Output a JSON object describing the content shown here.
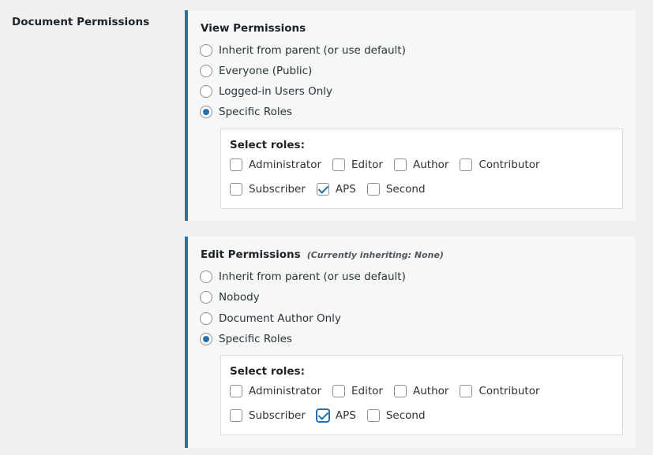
{
  "section_label": "Document Permissions",
  "view": {
    "title": "View Permissions",
    "options": [
      {
        "label": "Inherit from parent (or use default)",
        "checked": false
      },
      {
        "label": "Everyone (Public)",
        "checked": false
      },
      {
        "label": "Logged-in Users Only",
        "checked": false
      },
      {
        "label": "Specific Roles",
        "checked": true
      }
    ],
    "roles_title": "Select roles:",
    "roles_row1": [
      {
        "label": "Administrator",
        "checked": false
      },
      {
        "label": "Editor",
        "checked": false
      },
      {
        "label": "Author",
        "checked": false
      },
      {
        "label": "Contributor",
        "checked": false
      }
    ],
    "roles_row2": [
      {
        "label": "Subscriber",
        "checked": false
      },
      {
        "label": "APS",
        "checked": true
      },
      {
        "label": "Second",
        "checked": false
      }
    ]
  },
  "edit": {
    "title": "Edit Permissions",
    "note": "(Currently inheriting: None)",
    "options": [
      {
        "label": "Inherit from parent (or use default)",
        "checked": false
      },
      {
        "label": "Nobody",
        "checked": false
      },
      {
        "label": "Document Author Only",
        "checked": false
      },
      {
        "label": "Specific Roles",
        "checked": true
      }
    ],
    "roles_title": "Select roles:",
    "roles_row1": [
      {
        "label": "Administrator",
        "checked": false
      },
      {
        "label": "Editor",
        "checked": false
      },
      {
        "label": "Author",
        "checked": false
      },
      {
        "label": "Contributor",
        "checked": false
      }
    ],
    "roles_row2": [
      {
        "label": "Subscriber",
        "checked": false
      },
      {
        "label": "APS",
        "checked": true,
        "focused": true
      },
      {
        "label": "Second",
        "checked": false
      }
    ]
  }
}
